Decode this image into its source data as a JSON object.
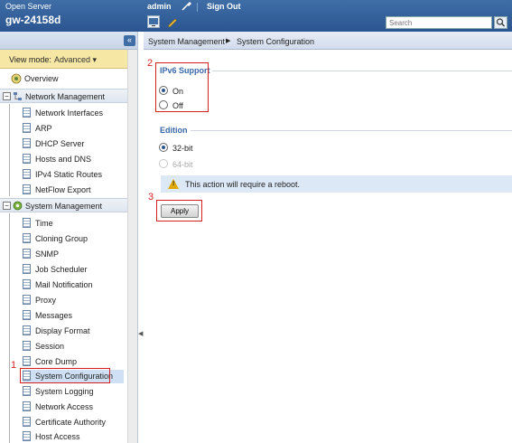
{
  "header": {
    "server_label": "Open Server",
    "hostname": "gw-24158d",
    "user": "admin",
    "sign_out": "Sign Out",
    "search_placeholder": "Search"
  },
  "sidebar": {
    "view_mode_label": "View mode:",
    "view_mode_value": "Advanced ▾",
    "overview": "Overview",
    "sections": [
      {
        "title": "Network Management",
        "items": [
          "Network Interfaces",
          "ARP",
          "DHCP Server",
          "Hosts and DNS",
          "IPv4 Static Routes",
          "NetFlow Export"
        ]
      },
      {
        "title": "System Management",
        "items": [
          "Time",
          "Cloning Group",
          "SNMP",
          "Job Scheduler",
          "Mail Notification",
          "Proxy",
          "Messages",
          "Display Format",
          "Session",
          "Core Dump",
          "System Configuration",
          "System Logging",
          "Network Access",
          "Certificate Authority",
          "Host Access"
        ]
      }
    ]
  },
  "breadcrumb": {
    "parent": "System Management",
    "current": "System Configuration"
  },
  "ipv6": {
    "legend": "IPv6 Support",
    "option_on": "On",
    "option_off": "Off"
  },
  "edition": {
    "legend": "Edition",
    "option_32": "32-bit",
    "option_64": "64-bit"
  },
  "note": "This action will require a reboot.",
  "apply_label": "Apply",
  "annotations": [
    "1",
    "2",
    "3"
  ],
  "colors": {
    "accent": "#2b5590",
    "annotation": "#d42020",
    "legend": "#3a67a8"
  }
}
